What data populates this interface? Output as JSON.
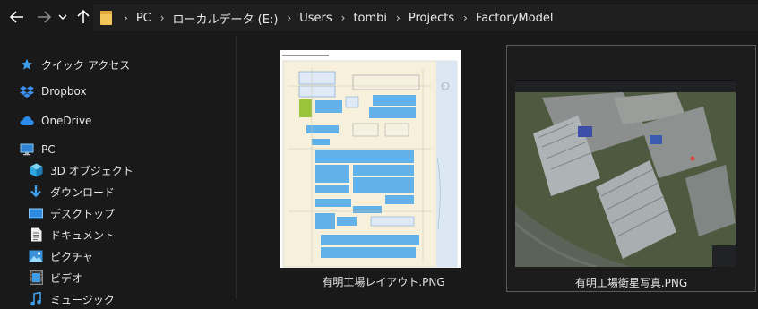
{
  "address": {
    "crumbs": [
      "PC",
      "ローカルデータ (E:)",
      "Users",
      "tombi",
      "Projects",
      "FactoryModel"
    ],
    "separator": "›"
  },
  "nav": {
    "back_icon": "arrow-left-icon",
    "forward_icon": "arrow-right-icon",
    "recent_icon": "chevron-down-icon",
    "up_icon": "arrow-up-icon"
  },
  "sidebar": {
    "items": [
      {
        "label": "クイック アクセス",
        "icon": "star-icon"
      },
      {
        "label": "Dropbox",
        "icon": "dropbox-icon"
      },
      {
        "label": "OneDrive",
        "icon": "cloud-icon"
      },
      {
        "label": "PC",
        "icon": "pc-icon"
      },
      {
        "label": "3D オブジェクト",
        "icon": "cube-icon"
      },
      {
        "label": "ダウンロード",
        "icon": "download-icon"
      },
      {
        "label": "デスクトップ",
        "icon": "desktop-icon"
      },
      {
        "label": "ドキュメント",
        "icon": "document-icon"
      },
      {
        "label": "ピクチャ",
        "icon": "picture-icon"
      },
      {
        "label": "ビデオ",
        "icon": "video-icon"
      },
      {
        "label": "ミュージック",
        "icon": "music-icon"
      }
    ]
  },
  "files": [
    {
      "name": "有明工場レイアウト.PNG",
      "kind": "layout-drawing",
      "selected": false
    },
    {
      "name": "有明工場衛星写真.PNG",
      "kind": "satellite-photo",
      "selected": true
    }
  ],
  "colors": {
    "background": "#191919",
    "selection_border": "#5a5a5a",
    "folder": "#f2c558",
    "accent_blue": "#3f9de8"
  }
}
